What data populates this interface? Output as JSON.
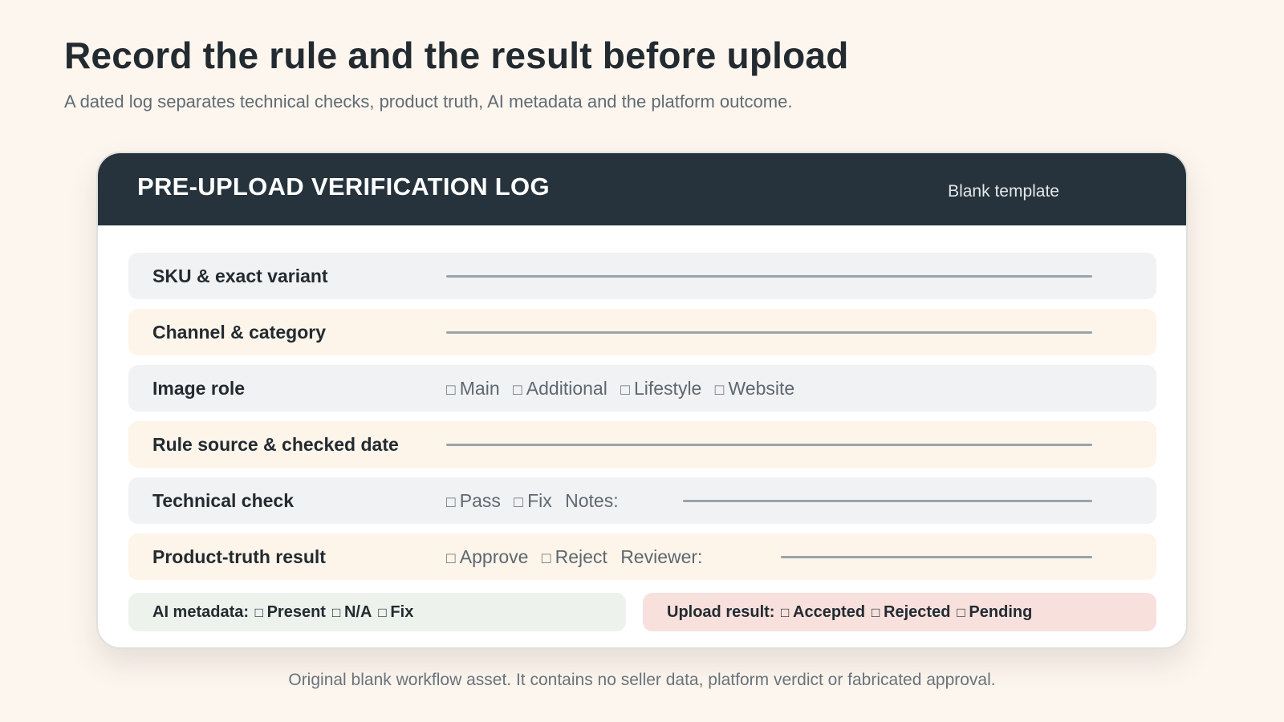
{
  "page": {
    "title": "Record the rule and the result before upload",
    "subtitle": "A dated log separates technical checks, product truth, AI metadata and the platform outcome."
  },
  "card": {
    "title": "PRE-UPLOAD VERIFICATION LOG",
    "tag": "Blank template",
    "header_color": "#26333c"
  },
  "rows": [
    {
      "label": "SKU & exact variant"
    },
    {
      "label": "Channel & category"
    },
    {
      "label": "Image role",
      "options": [
        "Main",
        "Additional",
        "Lifestyle",
        "Website"
      ]
    },
    {
      "label": "Rule source & checked date"
    },
    {
      "label": "Technical check",
      "options": [
        "Pass",
        "Fix"
      ],
      "trailing": "Notes:"
    },
    {
      "label": "Product-truth result",
      "options": [
        "Approve",
        "Reject"
      ],
      "trailing": "Reviewer:"
    }
  ],
  "ai_metadata": {
    "label": "AI metadata:",
    "options": [
      "Present",
      "N/A",
      "Fix"
    ],
    "color": "#edf2ec"
  },
  "upload_result": {
    "label": "Upload result:",
    "options": [
      "Accepted",
      "Rejected",
      "Pending"
    ],
    "color": "#f8e0dd"
  },
  "footnote": "Original blank workflow asset. It contains no seller data, platform verdict or fabricated approval."
}
